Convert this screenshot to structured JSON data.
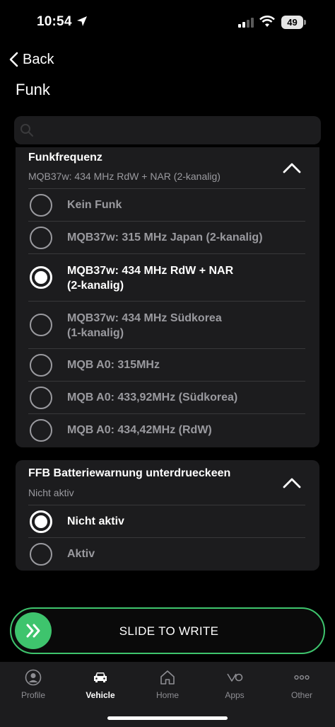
{
  "status_bar": {
    "time": "10:54",
    "battery_level": "49",
    "icons": [
      "location-arrow-icon",
      "cellular-signal-icon",
      "wifi-icon",
      "battery-icon"
    ]
  },
  "nav": {
    "back_label": "Back",
    "title": "Funk"
  },
  "search": {
    "placeholder": ""
  },
  "sections": [
    {
      "title": "Funkfrequenz",
      "subtitle": "MQB37w: 434 MHz RdW + NAR (2-kanalig)",
      "expanded": true,
      "options": [
        {
          "label": "Kein Funk",
          "selected": false
        },
        {
          "label": "MQB37w: 315 MHz Japan (2-kanalig)",
          "selected": false
        },
        {
          "label": "MQB37w: 434 MHz RdW + NAR\n(2-kanalig)",
          "selected": true
        },
        {
          "label": "MQB37w: 434 MHz Südkorea\n(1-kanalig)",
          "selected": false
        },
        {
          "label": "MQB A0: 315MHz",
          "selected": false
        },
        {
          "label": "MQB A0: 433,92MHz (Südkorea)",
          "selected": false
        },
        {
          "label": "MQB A0: 434,42MHz (RdW)",
          "selected": false
        }
      ]
    },
    {
      "title": "FFB Batteriewarnung unterdrueckeen",
      "subtitle": "Nicht aktiv",
      "expanded": true,
      "options": [
        {
          "label": "Nicht aktiv",
          "selected": true
        },
        {
          "label": "Aktiv",
          "selected": false
        }
      ]
    }
  ],
  "slide_button": {
    "label": "SLIDE TO WRITE"
  },
  "tabs": [
    {
      "label": "Profile",
      "icon": "profile-icon",
      "active": false
    },
    {
      "label": "Vehicle",
      "icon": "car-icon",
      "active": true
    },
    {
      "label": "Home",
      "icon": "home-icon",
      "active": false
    },
    {
      "label": "Apps",
      "icon": "apps-icon",
      "active": false
    },
    {
      "label": "Other",
      "icon": "more-icon",
      "active": false
    }
  ],
  "colors": {
    "background": "#000000",
    "card": "#1c1c1e",
    "accent_green": "#3ec46d",
    "muted_text": "#9a9a9f"
  }
}
